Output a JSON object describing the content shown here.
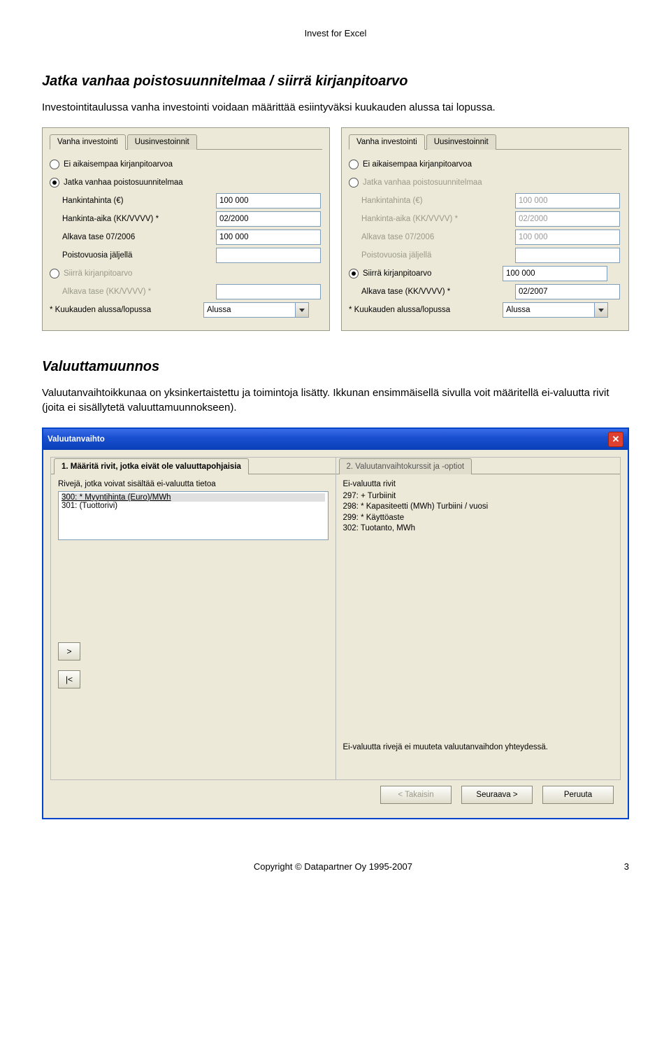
{
  "header": {
    "product": "Invest for Excel"
  },
  "section1": {
    "heading": "Jatka vanhaa poistosuunnitelmaa / siirrä kirjanpitoarvo",
    "paragraph": "Investointitaulussa vanha investointi voidaan määrittää esiintyväksi kuukauden alussa tai lopussa."
  },
  "panelA": {
    "tabs": {
      "t1": "Vanha investointi",
      "t2": "Uusinvestoinnit"
    },
    "r_no_prev": "Ei aikaisempaa kirjanpitoarvoa",
    "r_continue": "Jatka vanhaa poistosuunnitelmaa",
    "l_cost": "Hankintahinta (€)",
    "v_cost": "100 000",
    "l_time": "Hankinta-aika (KK/VVVV) *",
    "v_time": "02/2000",
    "l_opening": "Alkava tase 07/2006",
    "v_opening": "100 000",
    "l_years": "Poistovuosia jäljellä",
    "v_years": "",
    "r_transfer": "Siirrä kirjanpitoarvo",
    "l_opening2": "Alkava tase (KK/VVVV) *",
    "v_opening2": "",
    "note": "* Kuukauden alussa/lopussa",
    "combo": "Alussa"
  },
  "panelB": {
    "tabs": {
      "t1": "Vanha investointi",
      "t2": "Uusinvestoinnit"
    },
    "r_no_prev": "Ei aikaisempaa kirjanpitoarvoa",
    "r_continue": "Jatka vanhaa poistosuunnitelmaa",
    "l_cost": "Hankintahinta (€)",
    "v_cost": "100 000",
    "l_time": "Hankinta-aika (KK/VVVV) *",
    "v_time": "02/2000",
    "l_opening": "Alkava tase 07/2006",
    "v_opening": "100 000",
    "l_years": "Poistovuosia jäljellä",
    "v_years": "",
    "r_transfer": "Siirrä kirjanpitoarvo",
    "v_transfer_amt": "100 000",
    "l_opening2": "Alkava tase (KK/VVVV) *",
    "v_opening2": "02/2007",
    "note": "* Kuukauden alussa/lopussa",
    "combo": "Alussa"
  },
  "section2": {
    "heading": "Valuuttamuunnos",
    "paragraph": "Valuutanvaihtoikkunaa on yksinkertaistettu ja toimintoja lisätty. Ikkunan ensimmäisellä sivulla voit määritellä ei-valuutta rivit (joita ei sisällytetä valuuttamuunnokseen)."
  },
  "dialog": {
    "title": "Valuutanvaihto",
    "tab1": "1. Määritä rivit, jotka eivät ole valuuttapohjaisia",
    "tab2": "2. Valuutanvaihtokurssit ja -optiot",
    "left_caption": "Rivejä, jotka voivat sisältää ei-valuutta tietoa",
    "left_items": [
      "300: * Myyntihinta (Euro)/MWh",
      "301:                    (Tuottorivi)"
    ],
    "right_caption": "Ei-valuutta rivit",
    "right_items": [
      "297: + Turbiinit",
      "298: * Kapasiteetti (MWh) Turbiini / vuosi",
      "299: * Käyttöaste",
      "302: Tuotanto, MWh"
    ],
    "btn_right": ">",
    "btn_left": "|<",
    "bottom_note": "Ei-valuutta rivejä ei muuteta valuutanvaihdon yhteydessä.",
    "buttons": {
      "back": "< Takaisin",
      "next": "Seuraava >",
      "cancel": "Peruuta"
    }
  },
  "footer": {
    "copyright": "Copyright © Datapartner Oy 1995-2007",
    "page": "3"
  }
}
